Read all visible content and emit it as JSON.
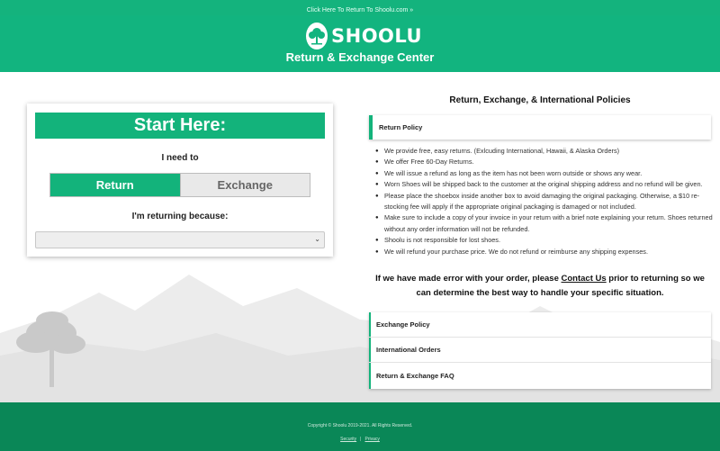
{
  "topbar": {
    "link": "Click Here To Return To Shoolu.com »"
  },
  "header": {
    "brand": "SHOOLU",
    "title": "Return & Exchange Center",
    "logo_icon": "tree-icon"
  },
  "form": {
    "banner": "Start Here:",
    "need_label": "I need to",
    "options": [
      "Return",
      "Exchange"
    ],
    "selected_option": "Return",
    "reason_label": "I'm returning because:",
    "reason_value": ""
  },
  "policies": {
    "title": "Return, Exchange, & International Policies",
    "return_policy_heading": "Return Policy",
    "items": [
      "We provide free, easy returns. (Exlcuding International, Hawaii, & Alaska Orders)",
      "We offer Free 60-Day Returns.",
      "We will issue a refund as long as the item has not been worn outside or shows any wear.",
      "Worn Shoes will be shipped back to the customer at the original shipping address and no refund will be given.",
      "Please place the shoebox inside another box to avoid damaging the original packaging. Otherwise, a $10 re-stocking fee will apply if the appropriate original packaging is damaged or not included.",
      "Make sure to include a copy of your invoice in your return with a brief note explaining your return. Shoes returned without any order information will not be refunded.",
      "Shoolu is not responsible for lost shoes.",
      "We will refund your purchase price. We do not refund or reimburse any shipping expenses."
    ],
    "contact_before": "If we have made error with your order, please",
    "contact_link": "Contact Us",
    "contact_after": "prior to returning so we can determine the best way to handle your specific situation.",
    "sections": [
      "Exchange Policy",
      "International Orders",
      "Return & Exchange FAQ"
    ]
  },
  "footer": {
    "copyright": "Copyright © Shoolu 2019-2021. All Rights Reserved.",
    "links": [
      "Security",
      "Privacy"
    ]
  },
  "colors": {
    "brand_green": "#13b37b",
    "footer_green": "#0a8757"
  }
}
